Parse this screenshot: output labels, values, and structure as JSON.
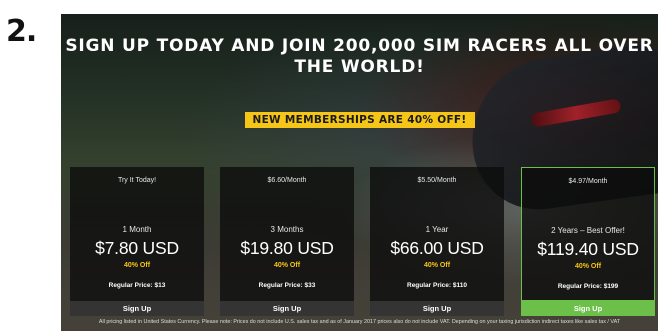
{
  "step": {
    "number": "2."
  },
  "hero": {
    "headline": "SIGN UP TODAY AND JOIN 200,000 SIM RACERS ALL OVER THE WORLD!",
    "promo": "NEW MEMBERSHIPS ARE 40% OFF!"
  },
  "plans": [
    {
      "top": "Try It Today!",
      "term": "1 Month",
      "price": "$7.80 USD",
      "discount": "40% Off",
      "regular": "Regular Price: $13",
      "signup": "Sign Up"
    },
    {
      "top": "$6.60/Month",
      "term": "3 Months",
      "price": "$19.80 USD",
      "discount": "40% Off",
      "regular": "Regular Price: $33",
      "signup": "Sign Up"
    },
    {
      "top": "$5.50/Month",
      "term": "1 Year",
      "price": "$66.00 USD",
      "discount": "40% Off",
      "regular": "Regular Price: $110",
      "signup": "Sign Up"
    },
    {
      "top": "$4.97/Month",
      "term": "2 Years – Best Offer!",
      "price": "$119.40 USD",
      "discount": "40% Off",
      "regular": "Regular Price: $199",
      "signup": "Sign Up"
    }
  ],
  "footer": {
    "fine_print": "All pricing listed in United States Currency. Please note: Prices do not include U.S. sales tax and as of January 2017 prices also do not include VAT. Depending on your taxing jurisdiction indirect taxes like sales tax / VAT"
  },
  "colors": {
    "accent_yellow": "#f5c518",
    "featured_green": "#6cc04a",
    "card_bg": "#0c0c0c"
  }
}
